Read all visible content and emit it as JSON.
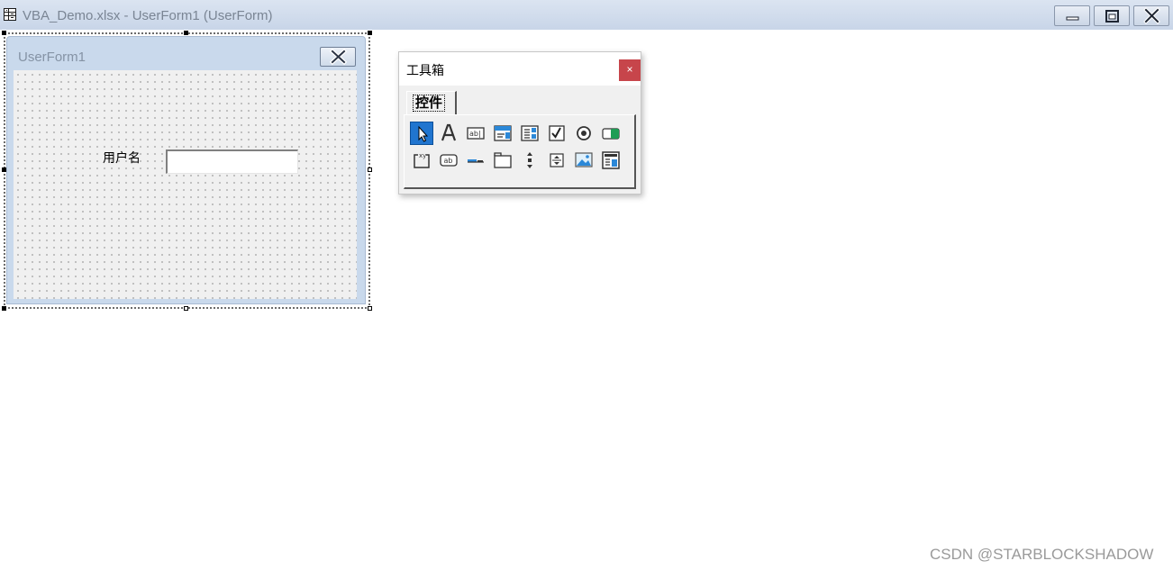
{
  "window": {
    "title": "VBA_Demo.xlsx - UserForm1 (UserForm)",
    "icon": "form-grid-icon",
    "controls": [
      "minimize-icon",
      "restore-icon",
      "close-icon"
    ]
  },
  "userform": {
    "caption": "UserForm1",
    "close_icon": "close-icon",
    "label_text": "用户名",
    "textbox_value": ""
  },
  "toolbox": {
    "title": "工具箱",
    "close_glyph": "×",
    "tab_label": "控件",
    "tools": [
      {
        "name": "select-objects-icon",
        "selected": true
      },
      {
        "name": "label-icon"
      },
      {
        "name": "textbox-icon"
      },
      {
        "name": "combobox-icon"
      },
      {
        "name": "listbox-icon"
      },
      {
        "name": "checkbox-icon"
      },
      {
        "name": "optionbutton-icon"
      },
      {
        "name": "togglebutton-icon"
      },
      {
        "name": "frame-icon"
      },
      {
        "name": "commandbutton-icon"
      },
      {
        "name": "tabstrip-icon"
      },
      {
        "name": "multipage-icon"
      },
      {
        "name": "scrollbar-icon"
      },
      {
        "name": "spinbutton-icon"
      },
      {
        "name": "image-icon"
      },
      {
        "name": "refedit-icon"
      }
    ]
  },
  "watermark": "CSDN @STARBLOCKSHADOW",
  "colors": {
    "titlebar": "#c8d5e8",
    "form_border": "#c9d9ec",
    "toolbox_close": "#c7454b",
    "tool_selected": "#2075cf"
  }
}
